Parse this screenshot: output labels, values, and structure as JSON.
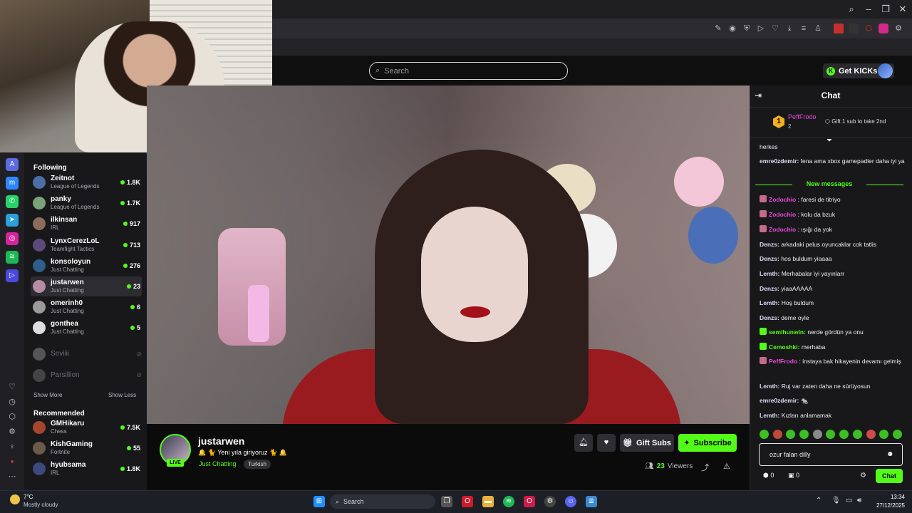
{
  "header": {
    "search_placeholder": "Search",
    "get_kicks_label": "Get KICKs"
  },
  "sidebar": {
    "following_heading": "Following",
    "show_more": "Show More",
    "show_less": "Show Less",
    "recommended_heading": "Recommended",
    "following": [
      {
        "name": "Zeitnot",
        "category": "League of Legends",
        "viewers": "1.8K",
        "color": "#4a6fa5"
      },
      {
        "name": "panky",
        "category": "League of Legends",
        "viewers": "1.7K",
        "color": "#7aa37a"
      },
      {
        "name": "ilkinsan",
        "category": "IRL",
        "viewers": "917",
        "color": "#8c6d5a"
      },
      {
        "name": "LynxCerezLoL",
        "category": "Teamfight Tactics",
        "viewers": "713",
        "color": "#5b4a7a"
      },
      {
        "name": "konsoloyun",
        "category": "Just Chatting",
        "viewers": "276",
        "color": "#2d5f8a"
      },
      {
        "name": "justarwen",
        "category": "Just Chatting",
        "viewers": "23",
        "color": "#b58ca4"
      },
      {
        "name": "omerinh0",
        "category": "Just Chatting",
        "viewers": "6",
        "color": "#9a9a9a"
      },
      {
        "name": "gonthea",
        "category": "Just Chatting",
        "viewers": "5",
        "color": "#dddddd"
      }
    ],
    "offline": [
      {
        "name": "Seviiii",
        "color": "#555555"
      },
      {
        "name": "Parsillion",
        "color": "#444444"
      }
    ],
    "recommended": [
      {
        "name": "GMHikaru",
        "category": "Chess",
        "viewers": "7.5K",
        "color": "#a5452d"
      },
      {
        "name": "KishGaming",
        "category": "Fortnite",
        "viewers": "55",
        "color": "#6a5a4a"
      },
      {
        "name": "hyubsama",
        "category": "IRL",
        "viewers": "1.8K",
        "color": "#3a4a7a"
      }
    ]
  },
  "stream": {
    "streamer": "justarwen",
    "live_label": "LIVE",
    "title": "🔔 🐈 Yeni yıla giriyoruz 🐈 🔔",
    "category": "Just Chatting",
    "tag": "Turkish",
    "gift_subs": "Gift Subs",
    "subscribe": "Subscribe",
    "viewers_count": "23",
    "viewers_label": "Viewers"
  },
  "chat": {
    "title": "Chat",
    "pinned": {
      "rank": "1",
      "name": "PeffFrodo",
      "count": "2",
      "gift_text": "Gift 1 sub to take 2nd"
    },
    "new_messages_label": "New messages",
    "messages": [
      {
        "user": "",
        "text": "herkes",
        "color": "#efeff1"
      },
      {
        "user": "emre0zdemir:",
        "text": "fena ama xbox gamepadler daha iyi ya",
        "color": "#dcdcf0"
      },
      {
        "user": "Zodochio",
        "text": ": faresi de titriyo",
        "color": "#e74ad9"
      },
      {
        "user": "Zodochio",
        "text": ": kolu da bzuk",
        "color": "#e74ad9"
      },
      {
        "user": "Zodochio",
        "text": ": ışığı da yok",
        "color": "#e74ad9"
      },
      {
        "user": "Denzs:",
        "text": "arkadaki pelus oyuncaklar cok tatlis",
        "color": "#dcdcf0"
      },
      {
        "user": "Denzs:",
        "text": "hos buldum yiaaaa",
        "color": "#dcdcf0"
      },
      {
        "user": "Lemth:",
        "text": "Merhabalar iyi yayınlarr",
        "color": "#dcdcf0"
      },
      {
        "user": "Denzs:",
        "text": "yiaaAAAAA",
        "color": "#dcdcf0"
      },
      {
        "user": "Lemth:",
        "text": "Hoş buldum",
        "color": "#dcdcf0"
      },
      {
        "user": "Denzs:",
        "text": "deme oyle",
        "color": "#dcdcf0"
      },
      {
        "user": "semihunwin:",
        "text": "nerde gördün ya onu",
        "color": "#53fc18"
      },
      {
        "user": "Cemoshki:",
        "text": "merhaba",
        "color": "#53fc18"
      },
      {
        "user": "PeffFrodo",
        "text": ": instaya bak hikayenin devamı gelmiş",
        "color": "#e74ad9"
      },
      {
        "user": "Lemth:",
        "text": "Ruj var zaten daha ne sürüyosun",
        "color": "#dcdcf0"
      },
      {
        "user": "emre0zdemir:",
        "text": "🐀",
        "color": "#dcdcf0"
      },
      {
        "user": "Lemth:",
        "text": "Kızları anlamamak",
        "color": "#dcdcf0"
      }
    ],
    "input_value": "ozur falan dilly",
    "points": "0",
    "drops": "0",
    "send_label": "Chat"
  },
  "taskbar": {
    "weather_temp": "7°C",
    "weather_desc": "Mostly cloudy",
    "search_label": "Search",
    "time": "13:34",
    "date": "27/12/2025"
  }
}
